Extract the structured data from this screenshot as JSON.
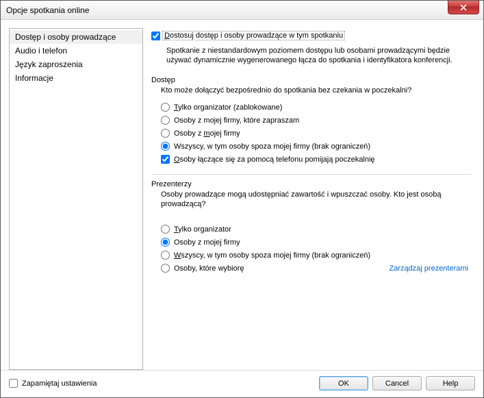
{
  "window": {
    "title": "Opcje spotkania online"
  },
  "nav": {
    "items": [
      {
        "label": "Dostęp i osoby prowadzące",
        "selected": true
      },
      {
        "label": "Audio i telefon",
        "selected": false
      },
      {
        "label": "Język zaproszenia",
        "selected": false
      },
      {
        "label": "Informacje",
        "selected": false
      }
    ]
  },
  "main": {
    "customize_pre": "D",
    "customize_post": "ostosuj dostęp i osoby prowadzące w tym spotkaniu",
    "info": "Spotkanie z niestandardowym poziomem dostępu lub osobami prowadzącymi będzie używać dynamicznie wygenerowanego łącza do spotkania i identyfikatora konferencji.",
    "access": {
      "label": "Dostęp",
      "desc": "Kto może dołączyć bezpośrednio do spotkania bez czekania w poczekalni?",
      "r1_pre": "T",
      "r1_post": "ylko organizator (zablokowane)",
      "r2": "Osoby z mojej firmy, które zapraszam",
      "r3_pre": "Osoby z ",
      "r3_u": "m",
      "r3_post": "ojej firmy",
      "r4": "Wszyscy, w tym osoby spoza mojej firmy (brak ograniczeń)",
      "cb_pre": "O",
      "cb_post": "soby łączące się za pomocą telefonu pomijają poczekalnię"
    },
    "presenters": {
      "label": "Prezenterzy",
      "desc": "Osoby prowadzące mogą udostępniać zawartość i wpuszczać osoby. Kto jest osobą prowadzącą?",
      "r1_pre": "T",
      "r1_post": "ylko organizator",
      "r2": "Osoby z mojej firmy",
      "r3_pre": "W",
      "r3_post": "szyscy, w tym osoby spoza mojej firmy (brak ograniczeń)",
      "r4": "Osoby, które wybiorę",
      "link": "Zarządzaj prezenterami"
    }
  },
  "footer": {
    "remember": "Zapamiętaj ustawienia",
    "ok": "OK",
    "cancel": "Cancel",
    "help": "Help"
  }
}
